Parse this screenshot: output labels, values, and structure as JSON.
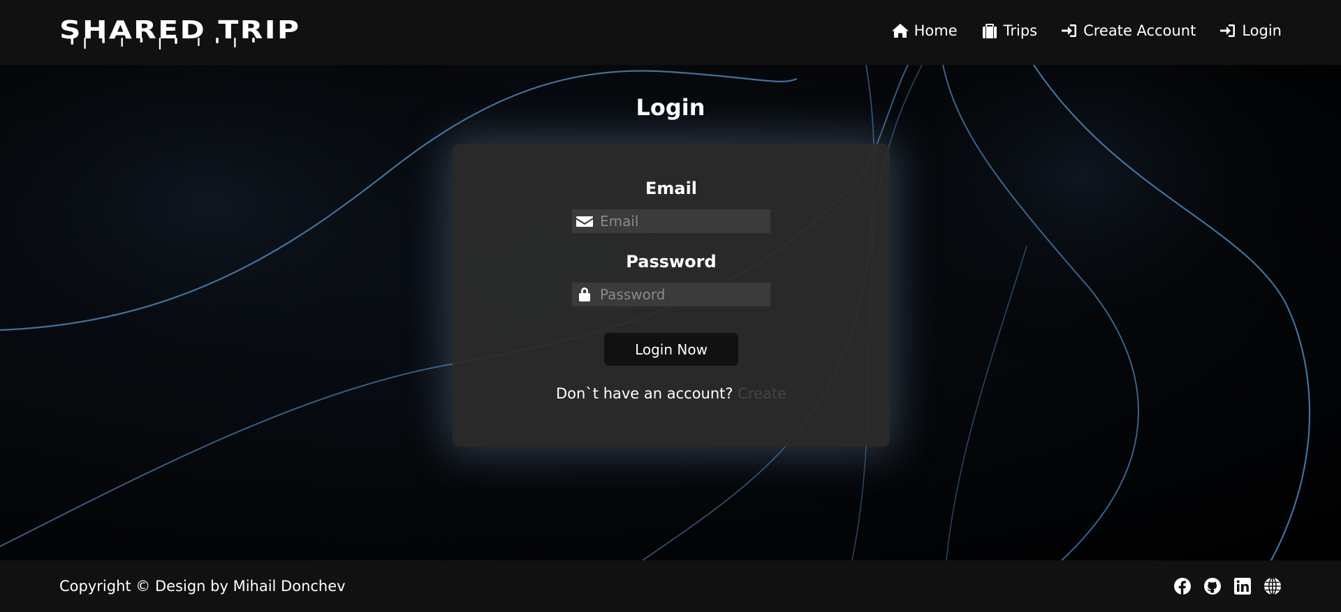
{
  "header": {
    "logo": "SHARED TRIP",
    "nav": [
      {
        "label": "Home",
        "icon": "home-icon"
      },
      {
        "label": "Trips",
        "icon": "suitcase-icon"
      },
      {
        "label": "Create Account",
        "icon": "sign-in-icon"
      },
      {
        "label": "Login",
        "icon": "sign-in-icon"
      }
    ]
  },
  "main": {
    "title": "Login",
    "form": {
      "email_label": "Email",
      "email_placeholder": "Email",
      "email_icon": "envelope-icon",
      "password_label": "Password",
      "password_placeholder": "Password",
      "password_icon": "lock-icon",
      "submit_label": "Login Now",
      "signup_text": "Don`t have an account?",
      "signup_link": "Create"
    }
  },
  "footer": {
    "copyright": "Copyright © Design by Mihail Donchev",
    "socials": [
      "facebook-icon",
      "github-icon",
      "linkedin-icon",
      "globe-icon"
    ]
  },
  "colors": {
    "bar_background": "#111111",
    "card_background": "#2c2c2c",
    "input_background": "#3b3b3b",
    "accent_lines": "#4f82b8",
    "muted_link": "#444444"
  }
}
